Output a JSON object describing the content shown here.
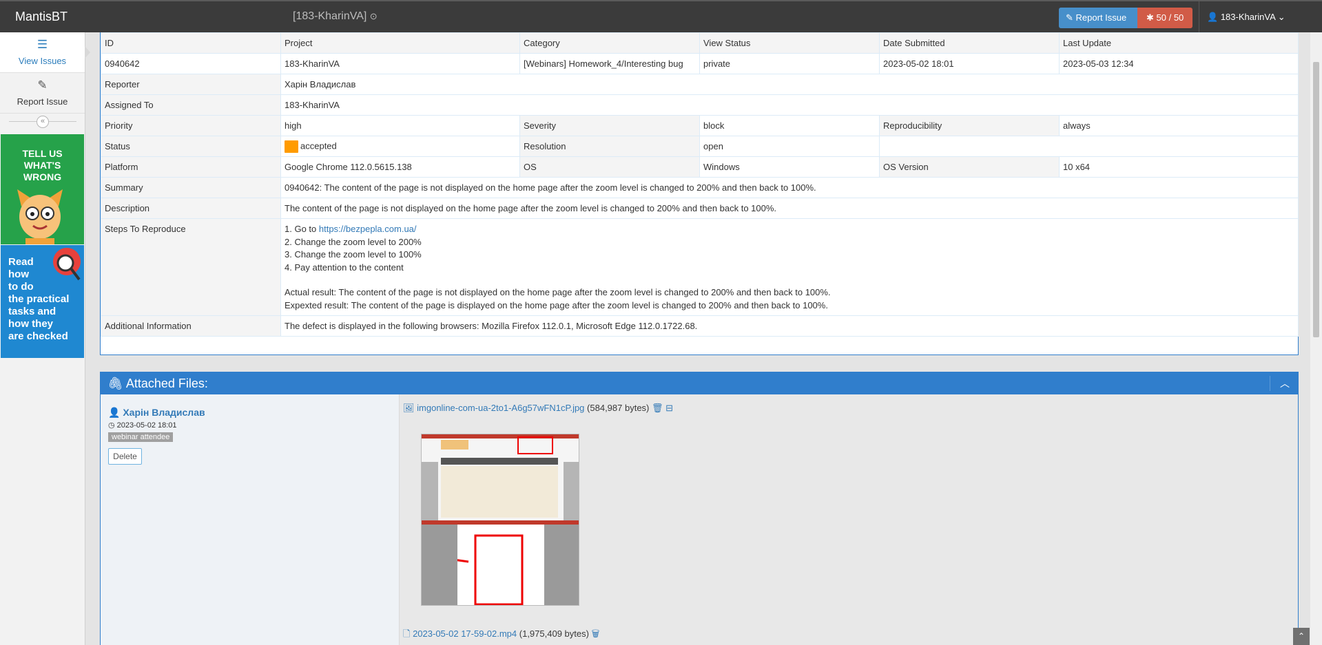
{
  "navbar": {
    "brand": "MantisBT",
    "project": "[183-KharinVA]",
    "report_issue": "Report Issue",
    "counter": "50 / 50",
    "user": "183-KharinVA"
  },
  "sidebar": {
    "items": [
      {
        "label": "View Issues",
        "icon": "list-icon"
      },
      {
        "label": "Report Issue",
        "icon": "edit-icon"
      }
    ],
    "ad_green": [
      "TELL US",
      "WHAT'S",
      "WRONG"
    ],
    "ad_blue": [
      "Read",
      "how",
      "to do",
      "the practical",
      "tasks and",
      "how they",
      "are checked"
    ]
  },
  "details": {
    "headers": [
      "ID",
      "Project",
      "Category",
      "View Status",
      "Date Submitted",
      "Last Update"
    ],
    "values": [
      "0940642",
      "183-KharinVA",
      "[Webinars] Homework_4/Interesting bug",
      "private",
      "2023-05-02 18:01",
      "2023-05-03 12:34"
    ],
    "reporter_label": "Reporter",
    "reporter": "Харін Владислав",
    "assigned_label": "Assigned To",
    "assigned": "183-KharinVA",
    "priority_label": "Priority",
    "priority": "high",
    "severity_label": "Severity",
    "severity": "block",
    "reproducibility_label": "Reproducibility",
    "reproducibility": "always",
    "status_label": "Status",
    "status": "accepted",
    "status_color": "#ff9b00",
    "resolution_label": "Resolution",
    "resolution": "open",
    "platform_label": "Platform",
    "platform": "Google Chrome 112.0.5615.138",
    "os_label": "OS",
    "os": "Windows",
    "os_version_label": "OS Version",
    "os_version": "10 x64",
    "summary_label": "Summary",
    "summary": "0940642: The content of the page is not displayed on the home page after the zoom level is changed to 200% and then back to 100%.",
    "description_label": "Description",
    "description": "The content of the page is not displayed on the home page after the zoom level is changed to 200% and then back to 100%.",
    "steps_label": "Steps To Reproduce",
    "step1_prefix": "1. Go to ",
    "step1_link": "https://bezpepla.com.ua/",
    "step2": "2. Change the zoom level to 200%",
    "step3": "3. Change the zoom level to 100%",
    "step4": "4. Pay attention to the content",
    "actual": "Actual result: The content of the page is not displayed on the home page after the zoom level is changed to 200% and then back to 100%.",
    "expected": "Expexted result: The content of the page is displayed on the home page after the zoom level is changed to 200% and then back to 100%.",
    "additional_label": "Additional Information",
    "additional": "The defect is displayed in the following browsers: Mozilla Firefox 112.0.1, Microsoft Edge 112.0.1722.68."
  },
  "files": {
    "title": "Attached Files:",
    "uploader": "Харін Владислав",
    "date": "2023-05-02 18:01",
    "badge": "webinar attendee",
    "delete": "Delete",
    "file1_name": "imgonline-com-ua-2to1-A6g57wFN1cP.jpg",
    "file1_size": "(584,987 bytes)",
    "file2_name": "2023-05-02 17-59-02.mp4",
    "file2_size": "(1,975,409 bytes)"
  }
}
